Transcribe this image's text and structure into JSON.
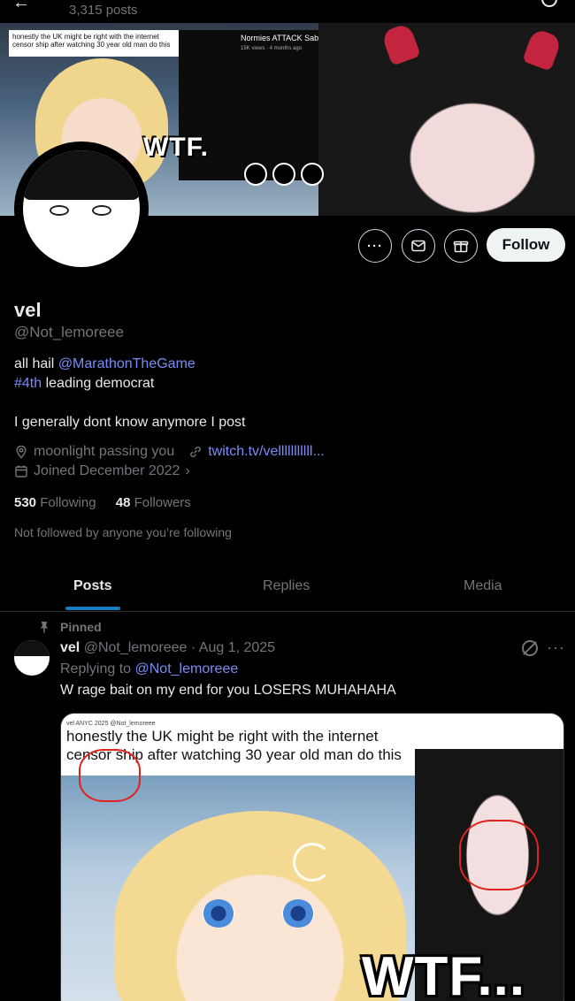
{
  "header": {
    "post_count": "3,315 posts"
  },
  "banner": {
    "caption": "honestly the UK might be right with the internet censor ship after watching 30 year old man do this",
    "video_title": "Normies ATTACK Saba Ov",
    "video_meta": "15K views · 4 months ago",
    "wtf_text": "WTF."
  },
  "actions": {
    "follow_label": "Follow"
  },
  "profile": {
    "name": "vel",
    "handle": "@Not_lemoreee",
    "bio_line1_prefix": "all hail ",
    "bio_line1_mention": "@MarathonTheGame",
    "bio_line2_hashtag": "#4th",
    "bio_line2_rest": " leading democrat",
    "bio_line3": "I generally dont know anymore I post",
    "location": "moonlight passing you",
    "website": "twitch.tv/velllllllllll...",
    "joined": "Joined December 2022",
    "following_count": "530",
    "following_label": "Following",
    "followers_count": "48",
    "followers_label": "Followers",
    "not_followed": "Not followed by anyone you’re following"
  },
  "tabs": [
    {
      "label": "Posts",
      "active": true
    },
    {
      "label": "Replies",
      "active": false
    },
    {
      "label": "Media",
      "active": false
    }
  ],
  "post": {
    "pinned_label": "Pinned",
    "author": "vel",
    "handle_date": "@Not_lemoreee · Aug 1, 2025",
    "replying_prefix": "Replying to ",
    "replying_handle": "@Not_lemoreee",
    "text": "W rage bait on my end for you LOSERS  MUHAHAHA",
    "media": {
      "user_line": "vel ANYC 2025 @Not_lemoreee",
      "caption_line1": "honestly the UK might be right with the internet",
      "caption_line2": "censor ship after watching 30 year old man do this",
      "wtf_text": "WTF..."
    }
  },
  "colors": {
    "background": "#000000",
    "text": "#e7e9ea",
    "muted": "#71767b",
    "link": "#7b8cf5",
    "accent": "#1d9bf0",
    "follow_bg": "#eff3f4"
  }
}
